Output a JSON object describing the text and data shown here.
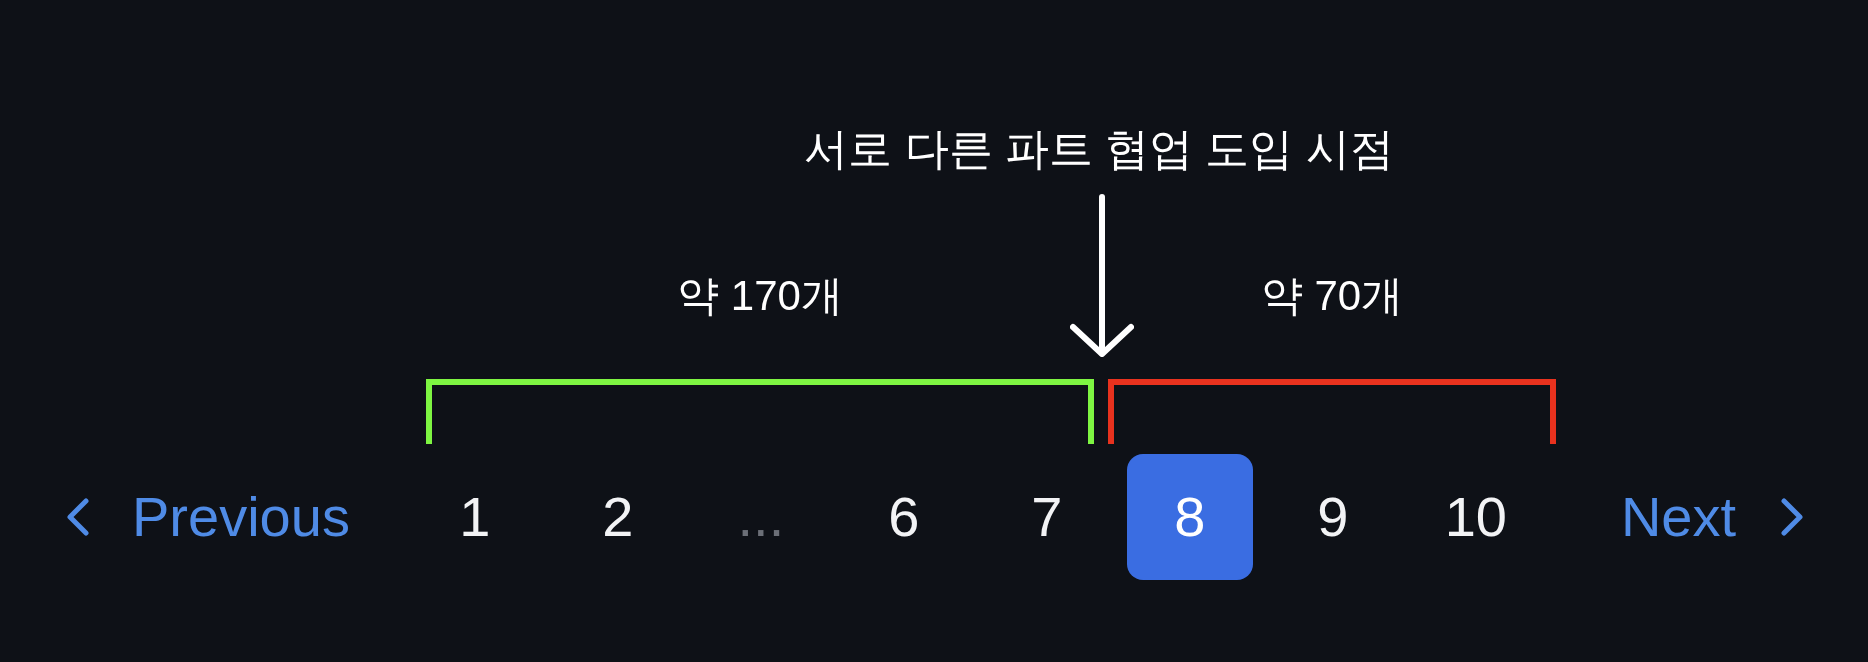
{
  "annotation": {
    "title": "서로 다른 파트 협업 도입 시점",
    "segments": [
      {
        "label": "약 170개",
        "color": "#7ef542"
      },
      {
        "label": "약 70개",
        "color": "#e8321e"
      }
    ]
  },
  "pagination": {
    "previous": "Previous",
    "next": "Next",
    "pages": [
      {
        "kind": "page",
        "label": "1",
        "selected": false
      },
      {
        "kind": "page",
        "label": "2",
        "selected": false
      },
      {
        "kind": "ellipsis",
        "label": "...",
        "selected": false
      },
      {
        "kind": "page",
        "label": "6",
        "selected": false
      },
      {
        "kind": "page",
        "label": "7",
        "selected": false
      },
      {
        "kind": "page",
        "label": "8",
        "selected": true
      },
      {
        "kind": "page",
        "label": "9",
        "selected": false
      },
      {
        "kind": "page",
        "label": "10",
        "selected": false
      }
    ]
  }
}
